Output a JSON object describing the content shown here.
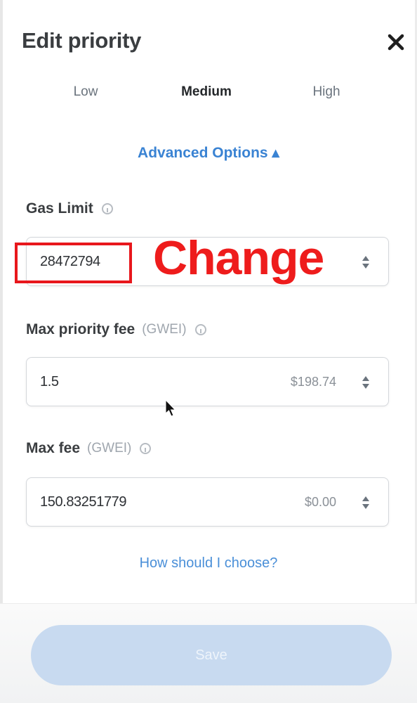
{
  "dialog": {
    "title": "Edit priority",
    "close_icon": "close-icon"
  },
  "tabs": [
    {
      "label": "Low",
      "active": false
    },
    {
      "label": "Medium",
      "active": true
    },
    {
      "label": "High",
      "active": false
    }
  ],
  "advanced_options": {
    "label": "Advanced Options ▴"
  },
  "gas_limit": {
    "label": "Gas Limit",
    "value": "28472794"
  },
  "max_priority_fee": {
    "label": "Max priority fee",
    "unit": "(GWEI)",
    "value": "1.5",
    "fiat": "$198.74"
  },
  "max_fee": {
    "label": "Max fee",
    "unit": "(GWEI)",
    "value": "150.83251779",
    "fiat": "$0.00"
  },
  "help_link": "How should I choose?",
  "footer": {
    "save_label": "Save"
  },
  "annotation": {
    "text": "Change",
    "color": "#ee1c1c"
  },
  "colors": {
    "accent": "#3a83d3",
    "button_disabled": "#c8daf0"
  }
}
